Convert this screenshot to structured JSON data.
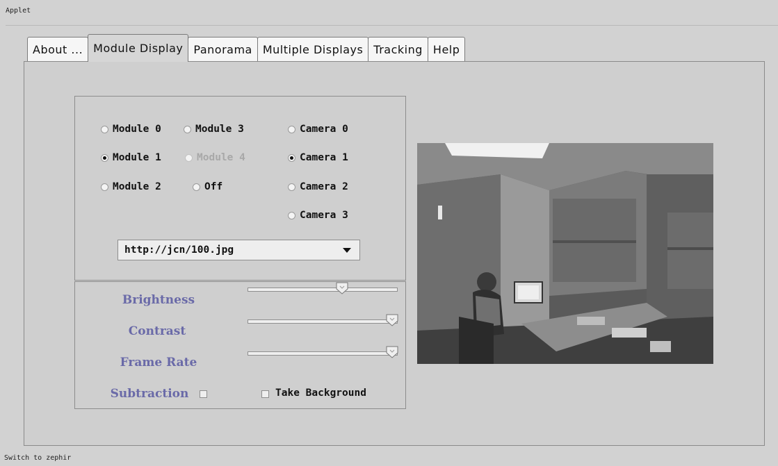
{
  "window": {
    "title": "Applet"
  },
  "tabs": [
    {
      "label": "About ..."
    },
    {
      "label": "Module Display",
      "selected": true
    },
    {
      "label": "Panorama"
    },
    {
      "label": "Multiple Displays"
    },
    {
      "label": "Tracking"
    },
    {
      "label": "Help"
    }
  ],
  "modules": [
    {
      "label": "Module 0",
      "checked": false,
      "enabled": true
    },
    {
      "label": "Module 1",
      "checked": true,
      "enabled": true
    },
    {
      "label": "Module 2",
      "checked": false,
      "enabled": true
    },
    {
      "label": "Module 3",
      "checked": false,
      "enabled": true
    },
    {
      "label": "Module 4",
      "checked": false,
      "enabled": false
    },
    {
      "label": "Off",
      "checked": false,
      "enabled": true
    }
  ],
  "cameras": [
    {
      "label": "Camera 0",
      "checked": false
    },
    {
      "label": "Camera 1",
      "checked": true
    },
    {
      "label": "Camera 2",
      "checked": false
    },
    {
      "label": "Camera 3",
      "checked": false
    }
  ],
  "source_select": {
    "value": "http://jcn/100.jpg"
  },
  "sliders": {
    "brightness": {
      "label": "Brightness",
      "value": 0.64
    },
    "contrast": {
      "label": "Contrast",
      "value": 1.0
    },
    "frame_rate": {
      "label": "Frame Rate",
      "value": 1.0
    }
  },
  "subtraction": {
    "label": "Subtraction",
    "checked": false
  },
  "take_background": {
    "label": "Take Background",
    "checked": false
  },
  "status_bar": {
    "text": "Switch to zephir"
  }
}
